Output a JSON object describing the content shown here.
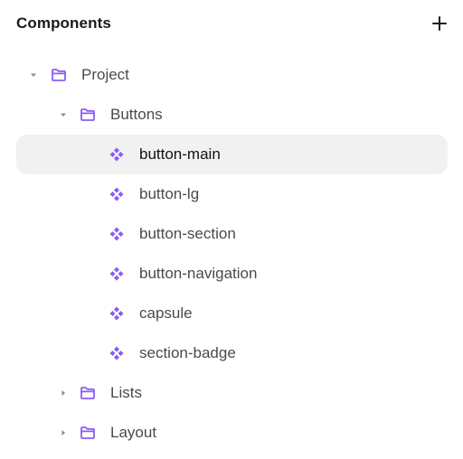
{
  "panel": {
    "title": "Components",
    "add_icon": "plus-icon"
  },
  "tree": [
    {
      "label": "Project",
      "type": "folder",
      "depth": 0,
      "expanded": true,
      "icon": "folder-icon"
    },
    {
      "label": "Buttons",
      "type": "folder",
      "depth": 1,
      "expanded": true,
      "icon": "folder-icon"
    },
    {
      "label": "button-main",
      "type": "component",
      "depth": 2,
      "selected": true,
      "icon": "component-icon"
    },
    {
      "label": "button-lg",
      "type": "component",
      "depth": 2,
      "icon": "component-icon"
    },
    {
      "label": "button-section",
      "type": "component",
      "depth": 2,
      "icon": "component-icon"
    },
    {
      "label": "button-navigation",
      "type": "component",
      "depth": 2,
      "icon": "component-icon"
    },
    {
      "label": "capsule",
      "type": "component",
      "depth": 2,
      "icon": "component-icon"
    },
    {
      "label": "section-badge",
      "type": "component",
      "depth": 2,
      "icon": "component-icon"
    },
    {
      "label": "Lists",
      "type": "folder",
      "depth": 1,
      "expanded": false,
      "icon": "folder-icon"
    },
    {
      "label": "Layout",
      "type": "folder",
      "depth": 1,
      "expanded": false,
      "icon": "folder-icon"
    }
  ],
  "colors": {
    "accent": "#8b5cf6",
    "selected_background": "#f1f1f1",
    "caret": "#8a8a8a"
  }
}
